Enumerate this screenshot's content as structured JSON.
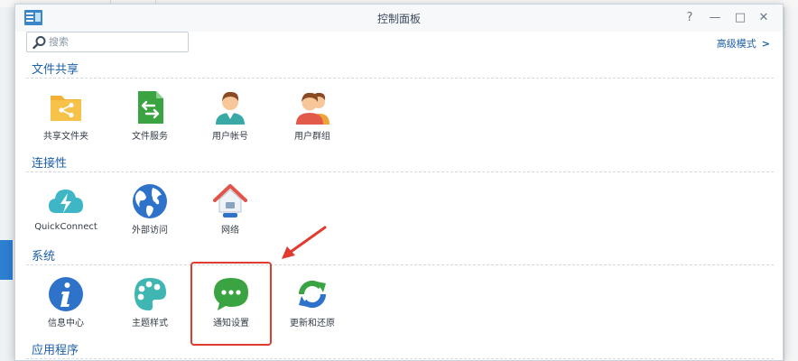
{
  "window": {
    "title": "控制面板",
    "help_label": "?",
    "minimize_label": "—",
    "maximize_label": "□",
    "close_label": "✕"
  },
  "search": {
    "placeholder": "搜索"
  },
  "advanced_mode": {
    "label": "高级模式",
    "chevron": ">"
  },
  "sections": [
    {
      "title": "文件共享",
      "items": [
        {
          "label": "共享文件夹",
          "icon": "shared-folder-icon"
        },
        {
          "label": "文件服务",
          "icon": "file-services-icon"
        },
        {
          "label": "用户帐号",
          "icon": "user-icon"
        },
        {
          "label": "用户群组",
          "icon": "group-icon"
        }
      ]
    },
    {
      "title": "连接性",
      "items": [
        {
          "label": "QuickConnect",
          "icon": "quickconnect-icon"
        },
        {
          "label": "外部访问",
          "icon": "external-access-icon"
        },
        {
          "label": "网络",
          "icon": "network-icon"
        }
      ]
    },
    {
      "title": "系统",
      "items": [
        {
          "label": "信息中心",
          "icon": "info-center-icon"
        },
        {
          "label": "主题样式",
          "icon": "theme-icon"
        },
        {
          "label": "通知设置",
          "icon": "notification-icon"
        },
        {
          "label": "更新和还原",
          "icon": "update-restore-icon"
        }
      ]
    },
    {
      "title": "应用程序",
      "items": []
    }
  ],
  "annotation": {
    "highlighted_item": "通知设置",
    "color": "#e13b30"
  },
  "colors": {
    "section_title": "#1e5fa8",
    "accent_red": "#e13b30",
    "titlebar": "#f6f8fa"
  }
}
